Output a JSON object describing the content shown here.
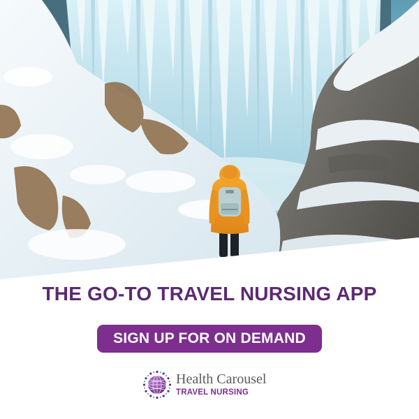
{
  "headline": "THE GO-TO TRAVEL NURSING APP",
  "cta_label": "SIGN UP FOR ON DEMAND",
  "brand": {
    "name": "Health Carousel",
    "tagline": "TRAVEL NURSING",
    "logo_icon": "globe-carousel-icon"
  },
  "photo_subject": "hiker-with-backpack",
  "colors": {
    "brand_purple": "#5c2a73",
    "cta_background": "#7d2e8e",
    "cta_text": "#ffffff",
    "logo_name_gray": "#5a5a5a"
  }
}
